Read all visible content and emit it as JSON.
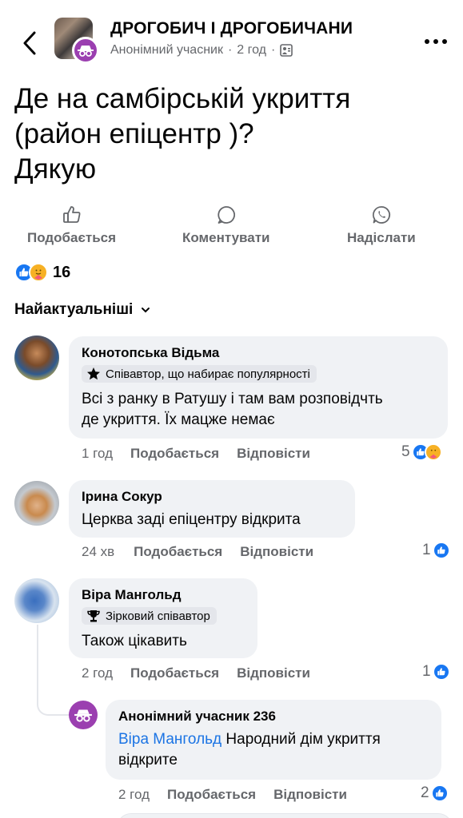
{
  "header": {
    "group_name": "ДРОГОБИЧ І ДРОГОБИЧАНИ",
    "author": "Анонімний учасник",
    "time": "2 год"
  },
  "post": {
    "text_line1": "Де на самбірській укриття",
    "text_line2": "(район епіцентр )?",
    "text_line3": "Дякую"
  },
  "actions": {
    "like": "Подобається",
    "comment": "Коментувати",
    "send": "Надіслати"
  },
  "reactions": {
    "count": "16"
  },
  "sort": {
    "label": "Найактуальніші"
  },
  "comments": [
    {
      "name": "Конотопська Відьма",
      "badge": "Співавтор, що набирає популярності",
      "text_line1": "Всі з ранку в Ратушу і там вам розповідчть",
      "text_line2": "де укриття. Їх мацже немає",
      "time": "1 год",
      "like": "Подобається",
      "reply": "Відповісти",
      "reaction_count": "5"
    },
    {
      "name": "Ірина Сокур",
      "text_line1": "Церква заді епіцентру відкрита",
      "time": "24 хв",
      "like": "Подобається",
      "reply": "Відповісти",
      "reaction_count": "1"
    },
    {
      "name": "Віра Мангольд",
      "badge": "Зірковий співавтор",
      "text_line1": "Також цікавить",
      "time": "2 год",
      "like": "Подобається",
      "reply": "Відповісти",
      "reaction_count": "1"
    }
  ],
  "reply": {
    "name": "Анонімний учасник 236",
    "mention": "Віра Мангольд",
    "text_rest": "Народний дім укриття",
    "text_line2": "відкрите",
    "time": "2 год",
    "like": "Подобається",
    "reply": "Відповісти",
    "reaction_count": "2"
  },
  "colors": {
    "accent": "#1877f2",
    "secondary_text": "#65676b",
    "bubble": "#f0f2f5",
    "anon_purple": "#9b3fb0"
  }
}
